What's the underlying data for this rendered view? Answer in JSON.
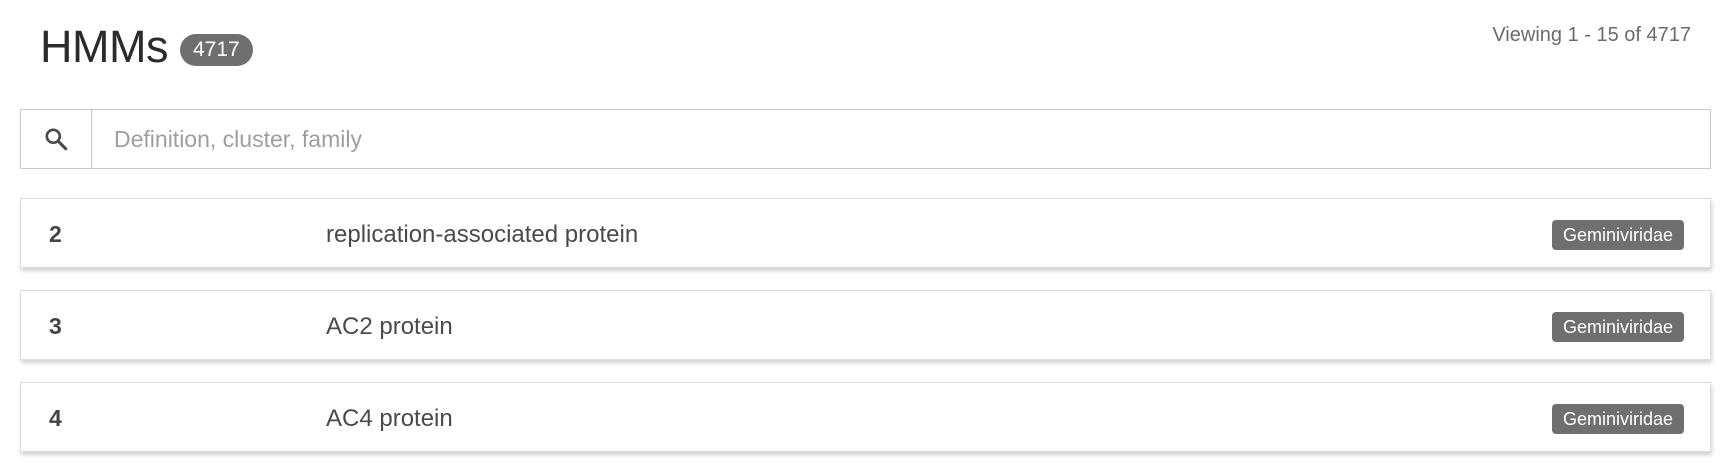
{
  "header": {
    "title": "HMMs",
    "count": "4717",
    "viewing": "Viewing 1 - 15 of 4717"
  },
  "search": {
    "icon": "search-icon",
    "placeholder": "Definition, cluster, family",
    "value": ""
  },
  "rows": [
    {
      "id": "2",
      "definition": "replication-associated protein",
      "family": "Geminiviridae"
    },
    {
      "id": "3",
      "definition": "AC2 protein",
      "family": "Geminiviridae"
    },
    {
      "id": "4",
      "definition": "AC4 protein",
      "family": "Geminiviridae"
    }
  ]
}
